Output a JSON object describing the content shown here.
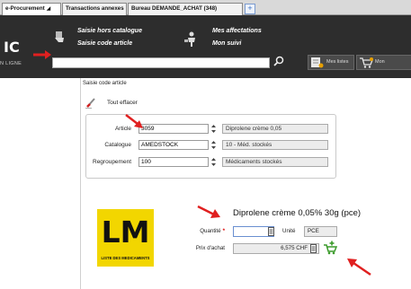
{
  "tabs": [
    {
      "label": "e-Procurement",
      "close": "◢"
    },
    {
      "label": "Transactions annexes",
      "close": ""
    },
    {
      "label": "Bureau DEMANDE_ACHAT (348)",
      "close": ""
    }
  ],
  "tab_add_label": "+",
  "header": {
    "brand": "IC",
    "brand_sub": "N LIGNE",
    "menu": {
      "saisie_hors_catalogue": "Saisie hors catalogue",
      "saisie_code_article": "Saisie code article",
      "mes_affectations": "Mes affectations",
      "mon_suivi": "Mon suivi"
    },
    "search_value": "",
    "buttons": {
      "mes_listes": "Mes listes",
      "mon_panier": "Mon"
    }
  },
  "page": {
    "title": "Saisie code article",
    "clear_label": "Tout effacer"
  },
  "fields": {
    "article": {
      "label": "Article",
      "value": "3059",
      "desc": "Diprolene crème 0,05"
    },
    "catalogue": {
      "label": "Catalogue",
      "value": "AMEDSTOCK",
      "desc": "10 - Méd. stockés"
    },
    "regroupement": {
      "label": "Regroupement",
      "value": "100",
      "desc": "Médicaments stockés"
    }
  },
  "logo": {
    "big": "LM",
    "small": "LISTE DES MEDICAMENTS"
  },
  "product": {
    "title": "Diprolene crème 0,05% 30g (pce)",
    "quantite_label": "Quantité",
    "required_mark": "*",
    "quantite_value": "",
    "unite_label": "Unité",
    "unite_value": "PCE",
    "prix_label": "Prix d'achat",
    "prix_value": "6,575 CHF"
  },
  "colors": {
    "header_bg": "#2d2d2d",
    "accent_red": "#e02020",
    "logo_yellow": "#f2d600",
    "cart_green": "#3a9a2a"
  }
}
